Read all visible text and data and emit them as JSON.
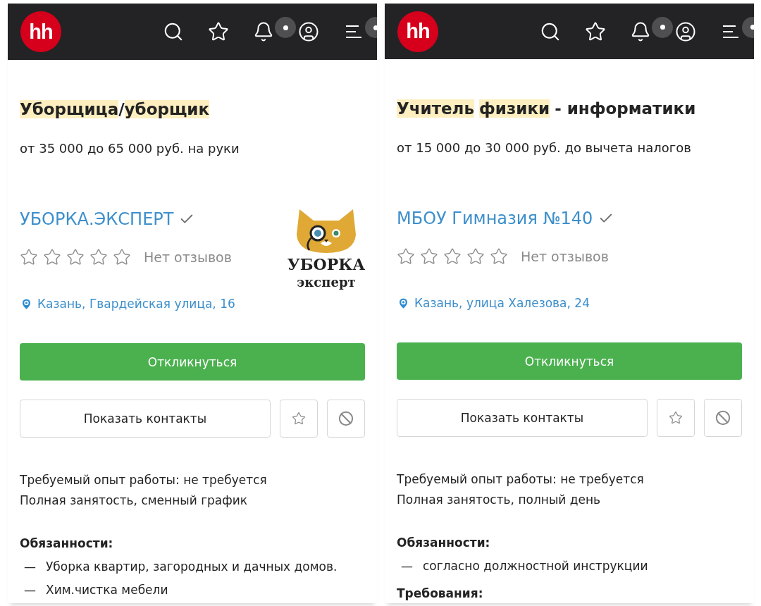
{
  "panels": [
    {
      "header": {
        "logo": "hh",
        "icons": [
          {
            "kind": "search",
            "badge": false
          },
          {
            "kind": "star",
            "badge": false
          },
          {
            "kind": "bell",
            "badge": true
          },
          {
            "kind": "profile",
            "badge": false
          },
          {
            "kind": "menu",
            "badge": true
          }
        ]
      },
      "title_parts": [
        {
          "text": "Уборщица",
          "highlighted": true
        },
        {
          "text": "/",
          "highlighted": false
        },
        {
          "text": "уборщик",
          "highlighted": true
        }
      ],
      "salary": "от 35 000 до 65 000 руб. на руки",
      "company": {
        "name": "УБОРКА.ЭКСПЕРТ",
        "verified": true,
        "logo": {
          "kind": "cat",
          "lines": [
            "УБОРКА",
            "эксперт"
          ]
        }
      },
      "stars": 0,
      "reviews": "Нет отзывов",
      "address": "Казань, Гвардейская улица, 16",
      "apply_button": "Откликнуться",
      "contacts_button": "Показать контакты",
      "conditions": [
        "Требуемый опыт работы: не требуется",
        "Полная занятость, сменный график"
      ],
      "sections": [
        {
          "heading": "Обязанности:",
          "items": [
            {
              "bullet": "—",
              "text": "Уборка квартир, загородных и дачных домов."
            },
            {
              "bullet": "—",
              "text": "Хим.чистка мебели"
            }
          ]
        }
      ]
    },
    {
      "header": {
        "logo": "hh",
        "icons": [
          {
            "kind": "search",
            "badge": false
          },
          {
            "kind": "star",
            "badge": false
          },
          {
            "kind": "bell",
            "badge": true
          },
          {
            "kind": "profile",
            "badge": false
          },
          {
            "kind": "menu",
            "badge": true
          }
        ]
      },
      "title_parts": [
        {
          "text": "Учитель",
          "highlighted": true
        },
        {
          "text": "физики",
          "highlighted": true,
          "space_before": true
        },
        {
          "text": "- информатики",
          "highlighted": false,
          "space_before": true
        }
      ],
      "salary": "от 15 000 до 30 000 руб. до вычета налогов",
      "company": {
        "name": "МБОУ Гимназия №140",
        "verified": true
      },
      "stars": 0,
      "reviews": "Нет отзывов",
      "address": "Казань, улица Халезова, 24",
      "apply_button": "Откликнуться",
      "contacts_button": "Показать контакты",
      "conditions": [
        "Требуемый опыт работы: не требуется",
        "Полная занятость, полный день"
      ],
      "sections": [
        {
          "heading": "Обязанности:",
          "items": [
            {
              "bullet": "—",
              "text": "согласно должностной инструкции"
            }
          ]
        },
        {
          "heading": "Требования:"
        }
      ]
    }
  ]
}
